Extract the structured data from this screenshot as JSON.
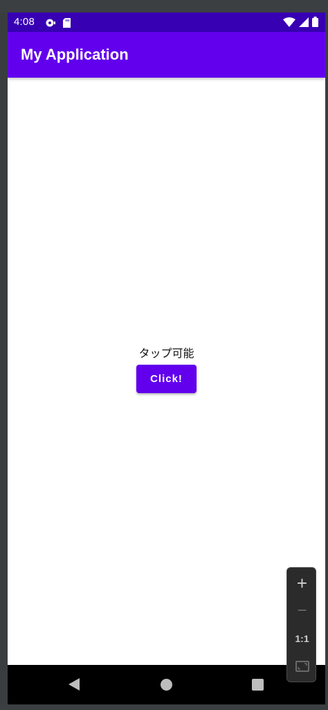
{
  "status_bar": {
    "time": "4:08",
    "left_icons": [
      "sync-notification-icon",
      "sd-card-icon"
    ],
    "right_icons": [
      "wifi-icon",
      "cell-signal-icon",
      "battery-icon"
    ]
  },
  "app_bar": {
    "title": "My Application"
  },
  "content": {
    "label": "タップ可能",
    "button_label": "Click!"
  },
  "nav_bar": {
    "buttons": [
      "back-icon",
      "home-icon",
      "recents-icon"
    ]
  },
  "zoom_controls": {
    "zoom_in": "+",
    "zoom_out": "−",
    "actual_size": "1:1",
    "fit_icon": "fit-screen-icon"
  },
  "colors": {
    "status_bar": "#3700b3",
    "primary": "#6200ee",
    "background": "#ffffff",
    "nav_bar": "#000000"
  }
}
